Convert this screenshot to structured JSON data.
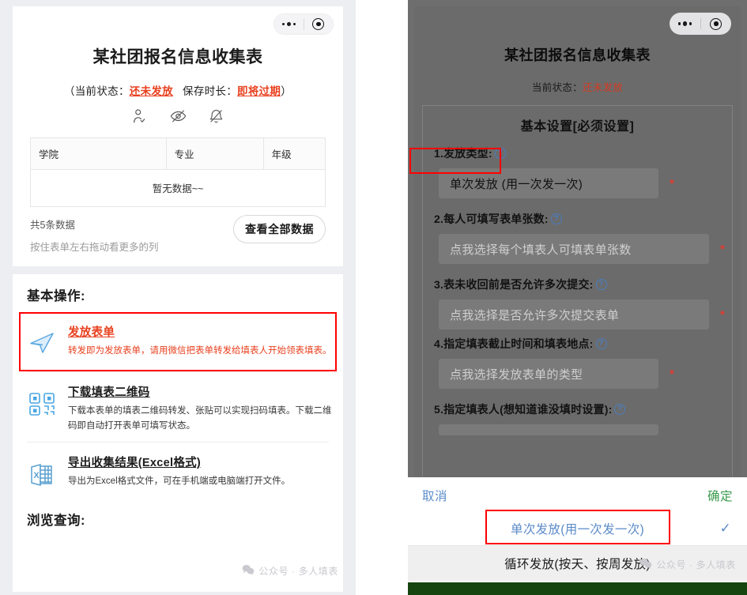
{
  "left_phone": {
    "capsule": {
      "more_icon": "more-dots-icon",
      "target_icon": "target-circle-icon"
    },
    "form_title": "某社团报名信息收集表",
    "status": {
      "prefix": "（当前状态：",
      "state_value": "还未发放",
      "middle": "保存时长：",
      "expiry_value": "即将过期",
      "suffix": "）"
    },
    "icons": [
      {
        "name": "person-check-icon",
        "label": "指定填表人"
      },
      {
        "name": "eye-off-icon",
        "label": "隐藏结果"
      },
      {
        "name": "bell-off-icon",
        "label": "关闭通知"
      }
    ],
    "table": {
      "headers": [
        "学院",
        "专业",
        "年级"
      ],
      "empty_text": "暂无数据~~",
      "count_text": "共5条数据",
      "drag_hint": "按住表单左右拖动看更多的列",
      "view_all_button": "查看全部数据"
    },
    "basic_ops_title": "基本操作:",
    "operations": [
      {
        "icon": "paper-plane-icon",
        "title": "发放表单",
        "desc": "转发即为发放表单，请用微信把表单转发给填表人开始领表填表。",
        "highlighted": true
      },
      {
        "icon": "qr-code-icon",
        "title": "下载填表二维码",
        "desc": "下载本表单的填表二维码转发、张贴可以实现扫码填表。下载二维码即自动打开表单可填写状态。",
        "highlighted": false
      },
      {
        "icon": "excel-file-icon",
        "title": "导出收集结果(Excel格式)",
        "desc": "导出为Excel格式文件，可在手机端或电脑端打开文件。",
        "highlighted": false
      }
    ],
    "browse_title": "浏览查询:",
    "watermark": "公众号 · 多人填表"
  },
  "right_phone": {
    "capsule": {
      "more_icon": "more-dots-icon",
      "target_icon": "target-circle-icon"
    },
    "form_title": "某社团报名信息收集表",
    "status": {
      "label": "当前状态：",
      "value": "还未发放"
    },
    "panel_title": "基本设置[必须设置]",
    "fields": [
      {
        "label": "1.发放类型:",
        "help_icon": "question-circle-icon",
        "value": "单次发放 (用一次发一次)",
        "is_placeholder": false,
        "required_mark": "*",
        "label_highlighted": true
      },
      {
        "label": "2.每人可填写表单张数:",
        "help_icon": "question-circle-icon",
        "value": "点我选择每个填表人可填表单张数",
        "is_placeholder": true,
        "required_mark": "*",
        "label_highlighted": false
      },
      {
        "label": "3.表未收回前是否允许多次提交:",
        "help_icon": "question-circle-icon",
        "value": "点我选择是否允许多次提交表单",
        "is_placeholder": true,
        "required_mark": "*",
        "label_highlighted": false
      },
      {
        "label": "4.指定填表截止时间和填表地点:",
        "help_icon": "question-circle-icon",
        "value": "点我选择发放表单的类型",
        "is_placeholder": true,
        "required_mark": "*",
        "label_highlighted": false
      },
      {
        "label": "5.指定填表人(想知道谁没填时设置):",
        "help_icon": "question-circle-icon",
        "value": "",
        "is_placeholder": true,
        "required_mark": "",
        "label_highlighted": false
      }
    ],
    "action_sheet": {
      "cancel": "取消",
      "confirm": "确定",
      "options": [
        {
          "label": "单次发放(用一次发一次)",
          "selected": true,
          "check_icon": "check-icon",
          "highlighted": true
        },
        {
          "label": "循环发放(按天、按周发放)",
          "selected": false,
          "check_icon": "",
          "highlighted": false
        }
      ]
    },
    "watermark": "公众号 · 多人填表"
  },
  "colors": {
    "accent_red": "#e8401f",
    "highlight_box": "#ff0000",
    "link_blue": "#5b8bc9",
    "confirm_green": "#3c9b4e",
    "bottom_bar_green": "#17450f",
    "dim_overlay": "#6e6e6e",
    "page_bg": "#eceef2"
  }
}
